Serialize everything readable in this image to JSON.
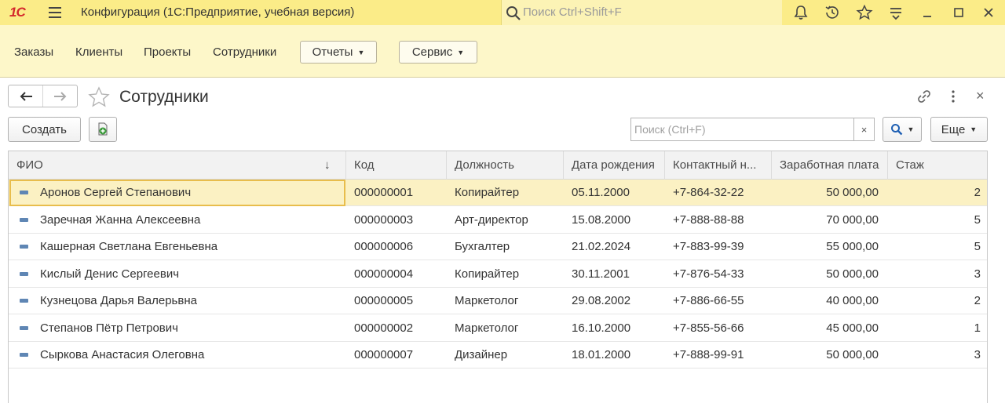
{
  "titlebar": {
    "logo": "1С",
    "title": "Конфигурация  (1С:Предприятие, учебная версия)",
    "search_placeholder": "Поиск Ctrl+Shift+F"
  },
  "sections": {
    "links": [
      "Заказы",
      "Клиенты",
      "Проекты",
      "Сотрудники"
    ],
    "reports_label": "Отчеты",
    "service_label": "Сервис"
  },
  "form": {
    "title": "Сотрудники",
    "create_label": "Создать",
    "search_placeholder": "Поиск (Ctrl+F)",
    "clear_label": "×",
    "more_label": "Еще",
    "close_label": "×"
  },
  "table": {
    "columns": [
      "ФИО",
      "Код",
      "Должность",
      "Дата рождения",
      "Контактный н...",
      "Заработная плата",
      "Стаж"
    ],
    "sort_indicator": "↓",
    "rows": [
      {
        "fio": "Аронов Сергей Степанович",
        "code": "000000001",
        "position": "Копирайтер",
        "birth": "05.11.2000",
        "phone": "+7-864-32-22",
        "salary": "50 000,00",
        "exp": "2"
      },
      {
        "fio": "Заречная Жанна Алексеевна",
        "code": "000000003",
        "position": "Арт-директор",
        "birth": "15.08.2000",
        "phone": "+7-888-88-88",
        "salary": "70 000,00",
        "exp": "5"
      },
      {
        "fio": "Кашерная Светлана Евгеньевна",
        "code": "000000006",
        "position": "Бухгалтер",
        "birth": "21.02.2024",
        "phone": "+7-883-99-39",
        "salary": "55 000,00",
        "exp": "5"
      },
      {
        "fio": "Кислый Денис Сергеевич",
        "code": "000000004",
        "position": "Копирайтер",
        "birth": "30.11.2001",
        "phone": "+7-876-54-33",
        "salary": "50 000,00",
        "exp": "3"
      },
      {
        "fio": "Кузнецова Дарья Валерьвна",
        "code": "000000005",
        "position": "Маркетолог",
        "birth": "29.08.2002",
        "phone": "+7-886-66-55",
        "salary": "40 000,00",
        "exp": "2"
      },
      {
        "fio": "Степанов Пётр Петрович",
        "code": "000000002",
        "position": "Маркетолог",
        "birth": "16.10.2000",
        "phone": "+7-855-56-66",
        "salary": "45 000,00",
        "exp": "1"
      },
      {
        "fio": "Сыркова Анастасия Олеговна",
        "code": "000000007",
        "position": "Дизайнер",
        "birth": "18.01.2000",
        "phone": "+7-888-99-91",
        "salary": "50 000,00",
        "exp": "3"
      }
    ],
    "selected_row": 0
  },
  "colors": {
    "titlebar_bg": "#fbec88",
    "sectionbar_bg": "#fdf7c9",
    "selected_row_bg": "#fbf1c3",
    "selected_cell_border": "#e8bd4c",
    "logo": "#d4282c"
  }
}
